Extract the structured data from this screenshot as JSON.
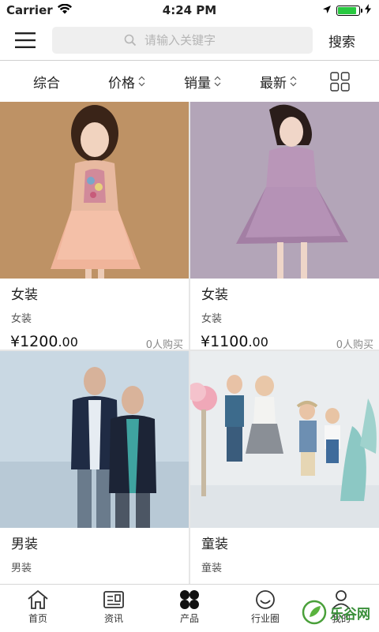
{
  "status_bar": {
    "carrier": "Carrier",
    "time": "4:24 PM",
    "battery_level": 0.9
  },
  "header": {
    "search_placeholder": "请输入关键字",
    "search_button": "搜索"
  },
  "filters": [
    {
      "label": "综合",
      "has_sort": false
    },
    {
      "label": "价格",
      "has_sort": true
    },
    {
      "label": "销量",
      "has_sort": true
    },
    {
      "label": "最新",
      "has_sort": true
    }
  ],
  "products": [
    {
      "name": "女装",
      "category": "女装",
      "price_symbol": "¥",
      "price_int": "1200",
      "price_dec": ".00",
      "sold": "0人购买"
    },
    {
      "name": "女装",
      "category": "女装",
      "price_symbol": "¥",
      "price_int": "1100",
      "price_dec": ".00",
      "sold": "0人购买"
    },
    {
      "name": "男装",
      "category": "男装"
    },
    {
      "name": "童装",
      "category": "童装"
    }
  ],
  "tabs": [
    {
      "label": "首页",
      "icon": "home-icon"
    },
    {
      "label": "资讯",
      "icon": "news-icon"
    },
    {
      "label": "产品",
      "icon": "products-icon",
      "active": true
    },
    {
      "label": "行业圈",
      "icon": "smiley-icon"
    },
    {
      "label": "我的",
      "icon": "user-icon"
    }
  ],
  "watermark": {
    "text": "乐谷网"
  },
  "colors": {
    "battery": "#28c840",
    "watermark": "#3a8f3a"
  }
}
